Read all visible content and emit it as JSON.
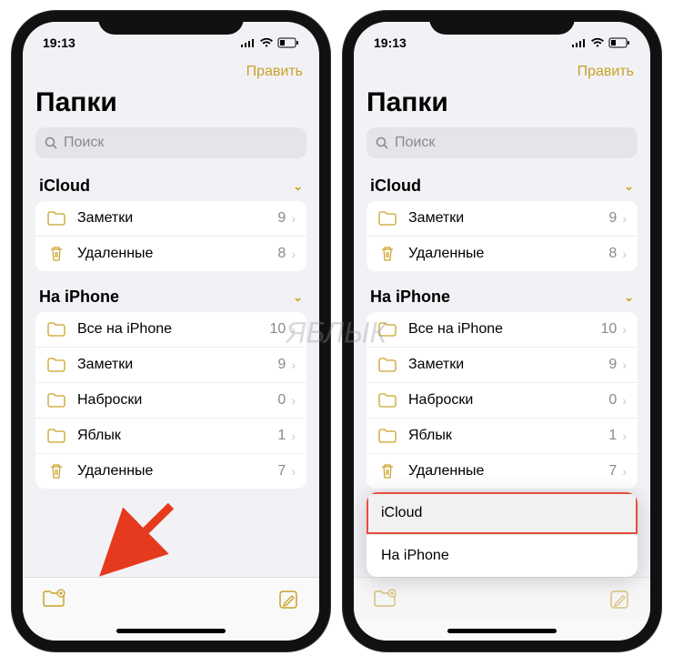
{
  "status": {
    "time": "19:13"
  },
  "nav": {
    "edit": "Править"
  },
  "title": "Папки",
  "search": {
    "placeholder": "Поиск"
  },
  "sections": [
    {
      "name": "iCloud",
      "rows": [
        {
          "icon": "folder",
          "label": "Заметки",
          "count": "9"
        },
        {
          "icon": "trash",
          "label": "Удаленные",
          "count": "8"
        }
      ]
    },
    {
      "name": "На iPhone",
      "rows": [
        {
          "icon": "folder",
          "label": "Все на iPhone",
          "count": "10"
        },
        {
          "icon": "folder",
          "label": "Заметки",
          "count": "9"
        },
        {
          "icon": "folder",
          "label": "Наброски",
          "count": "0"
        },
        {
          "icon": "folder",
          "label": "Яблык",
          "count": "1"
        },
        {
          "icon": "trash",
          "label": "Удаленные",
          "count": "7"
        }
      ]
    }
  ],
  "popup": {
    "opt1": "iCloud",
    "opt2": "На iPhone"
  },
  "watermark": "ЯБЛЫК"
}
